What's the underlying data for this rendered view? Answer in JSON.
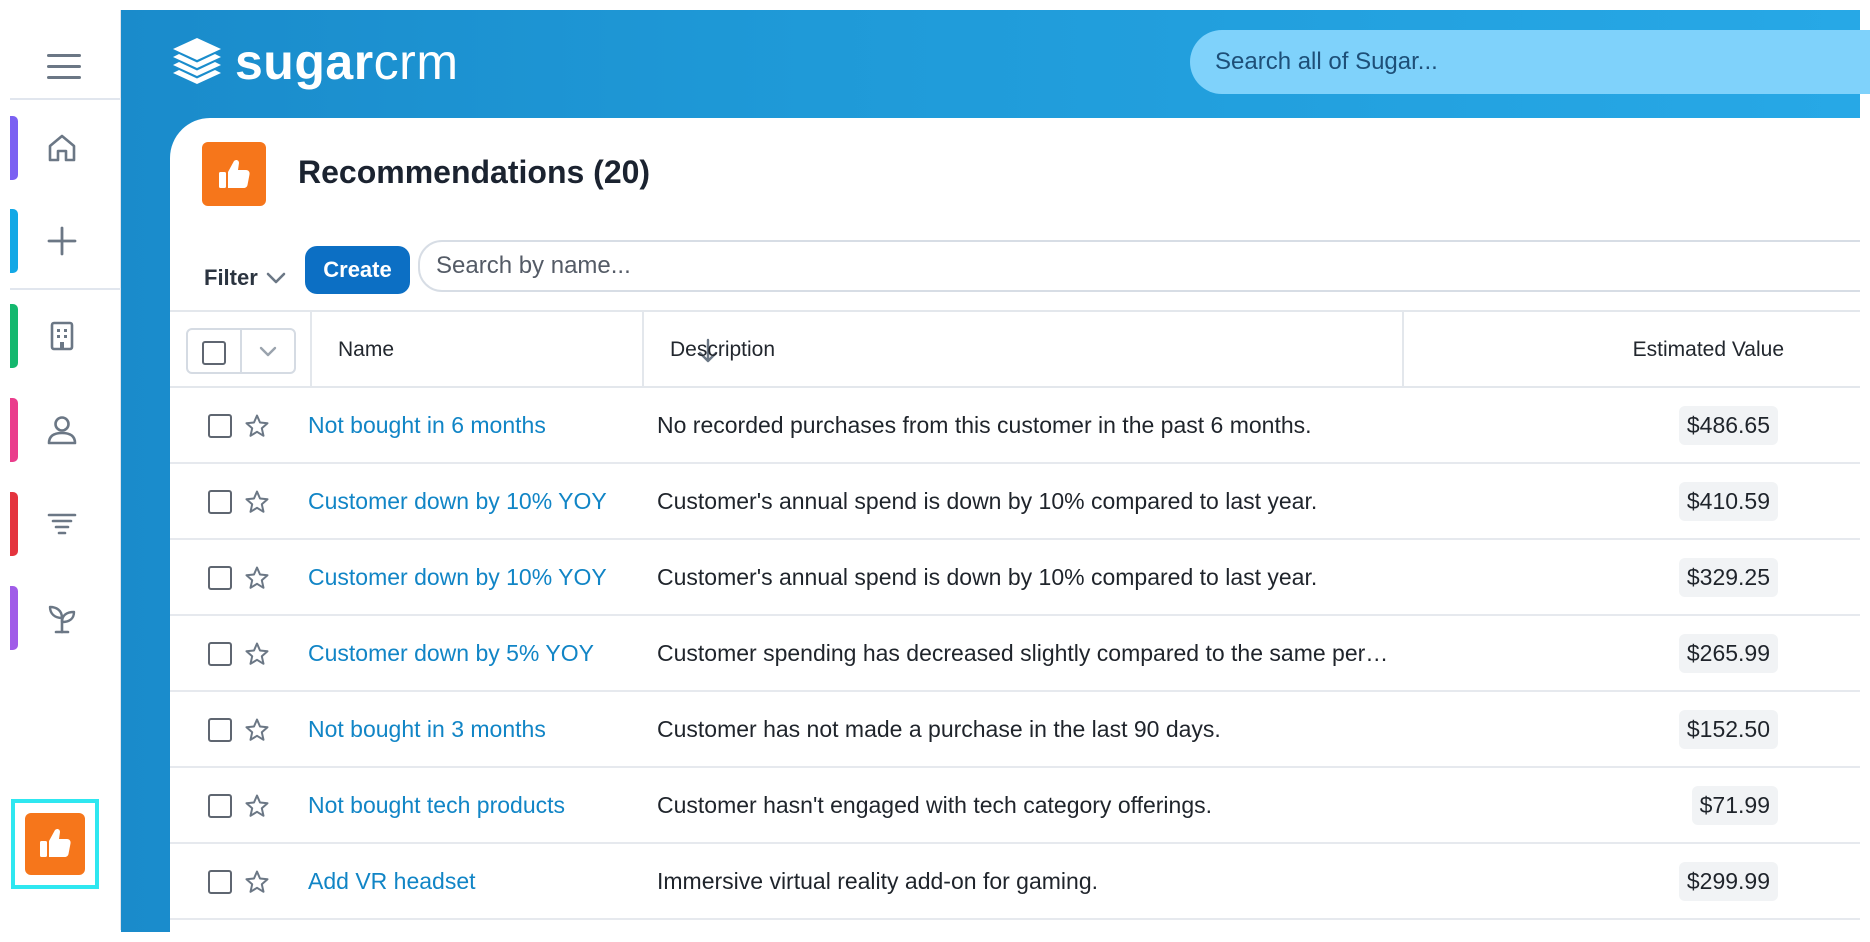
{
  "app": {
    "logo_bold": "sugar",
    "logo_light": "crm"
  },
  "global_search": {
    "placeholder": "Search all of Sugar..."
  },
  "sidebar": {
    "items": [
      {
        "name": "home",
        "icon": "home-icon",
        "accent": "#7b61f2"
      },
      {
        "name": "create",
        "icon": "plus-icon",
        "accent": "#12a8e6"
      },
      {
        "name": "accounts",
        "icon": "building-icon",
        "accent": "#14b86e"
      },
      {
        "name": "contacts",
        "icon": "person-icon",
        "accent": "#ea3d8c"
      },
      {
        "name": "filters",
        "icon": "funnel-lines-icon",
        "accent": "#e4343e"
      },
      {
        "name": "opportunities",
        "icon": "sprout-icon",
        "accent": "#a05ce8"
      },
      {
        "name": "recommendations",
        "icon": "thumbs-up-icon",
        "accent": "#f6761b"
      }
    ],
    "active": "recommendations"
  },
  "page": {
    "title": "Recommendations (20)",
    "module_icon": "thumbs-up-icon",
    "module_color": "#f6761b"
  },
  "toolbar": {
    "filter_label": "Filter",
    "create_label": "Create",
    "search_placeholder": "Search by name..."
  },
  "table": {
    "columns": {
      "name": "Name",
      "description": "Description",
      "estimated_value": "Estimated Value"
    },
    "rows": [
      {
        "name": "Not bought in 6 months",
        "description": "No recorded purchases from this customer in the past 6 months.",
        "value": "$486.65"
      },
      {
        "name": "Customer down by 10% YOY",
        "description": "Customer's annual spend is down by 10% compared to last year.",
        "value": "$410.59"
      },
      {
        "name": "Customer down by 10% YOY",
        "description": "Customer's annual spend is down by 10% compared to last year.",
        "value": "$329.25"
      },
      {
        "name": "Customer down by 5% YOY",
        "description": "Customer spending has decreased slightly compared to the same period la...",
        "value": "$265.99"
      },
      {
        "name": "Not bought in 3 months",
        "description": "Customer has not made a purchase in the last 90 days.",
        "value": "$152.50"
      },
      {
        "name": "Not bought tech products",
        "description": "Customer hasn't engaged with tech category offerings.",
        "value": "$71.99"
      },
      {
        "name": "Add VR headset",
        "description": "Immersive virtual reality add-on for gaming.",
        "value": "$299.99"
      }
    ]
  },
  "colors": {
    "header_blue": "#1f9ad8",
    "link_blue": "#1185c6",
    "create_button": "#0c6fc4",
    "active_highlight": "#2ee7f0"
  }
}
